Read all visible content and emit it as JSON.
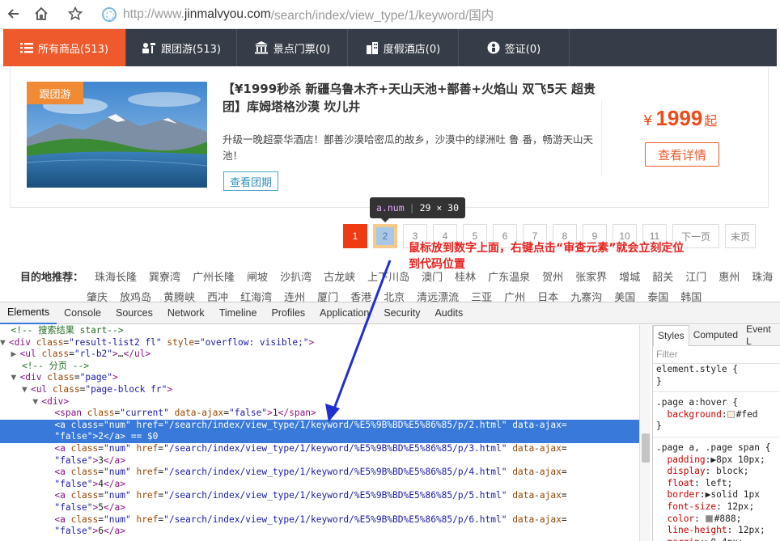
{
  "browser": {
    "url_prefix": "http://www.",
    "url_host": "jinmalvyou.com",
    "url_path": "/search/index/view_type/1/keyword/国内"
  },
  "tabs": [
    {
      "label": "所有商品(513)",
      "icon": "list-icon",
      "active": true
    },
    {
      "label": "跟团游(513)",
      "icon": "group-tour-icon"
    },
    {
      "label": "景点门票(0)",
      "icon": "temple-icon"
    },
    {
      "label": "度假酒店(0)",
      "icon": "hotel-icon"
    },
    {
      "label": "签证(0)",
      "icon": "visa-icon"
    }
  ],
  "product": {
    "badge": "跟团游",
    "title": "【¥1999秒杀 新疆乌鲁木齐+天山天池+鄯善+火焰山 双飞5天 超贵团】库姆塔格沙漠 坎儿井",
    "desc": "升级一晚超豪华酒店！鄯善沙漠哈密瓜的故乡，沙漠中的绿洲吐 鲁 番，畅游天山天池！",
    "view_group_label": "查看团期",
    "price_currency": "¥",
    "price": "1999",
    "price_suffix": "起",
    "detail_label": "查看详情"
  },
  "tooltip": {
    "selector": "a.num",
    "size": "29 × 30"
  },
  "pagination": {
    "pages": [
      "1",
      "2",
      "3",
      "4",
      "5",
      "6",
      "7",
      "8",
      "9",
      "10",
      "11"
    ],
    "next": "下一页",
    "last": "末页"
  },
  "annotation": {
    "line1": "鼠标放到数字上面，右键点击“审查元素”就会立刻定位",
    "line2": "到代码位置"
  },
  "destinations": {
    "label": "目的地推荐：",
    "row1": [
      "珠海长隆",
      "巽寮湾",
      "广州长隆",
      "闸坡",
      "沙扒湾",
      "古龙峡",
      "上下川岛",
      "澳门",
      "桂林",
      "广东温泉",
      "贺州",
      "张家界",
      "增城",
      "韶关",
      "江门",
      "惠州",
      "珠海"
    ],
    "row2": [
      "肇庆",
      "放鸡岛",
      "黄腾峡",
      "西冲",
      "红海湾",
      "连州",
      "厦门",
      "香港",
      "北京",
      "清远漂流",
      "三亚",
      "广州",
      "日本",
      "九寨沟",
      "美国",
      "泰国",
      "韩国"
    ]
  },
  "devtools": {
    "tabs": [
      "Elements",
      "Console",
      "Sources",
      "Network",
      "Timeline",
      "Profiles",
      "Application",
      "Security",
      "Audits"
    ],
    "styles_tabs": [
      "Styles",
      "Computed",
      "Event L"
    ],
    "filter_placeholder": "Filter"
  },
  "colors": {
    "accent": "#ee5a2b",
    "nav_bg": "#373d48",
    "selection": "#3879d9",
    "annotation": "#e8221e",
    "arrow": "#1f2fd0"
  }
}
